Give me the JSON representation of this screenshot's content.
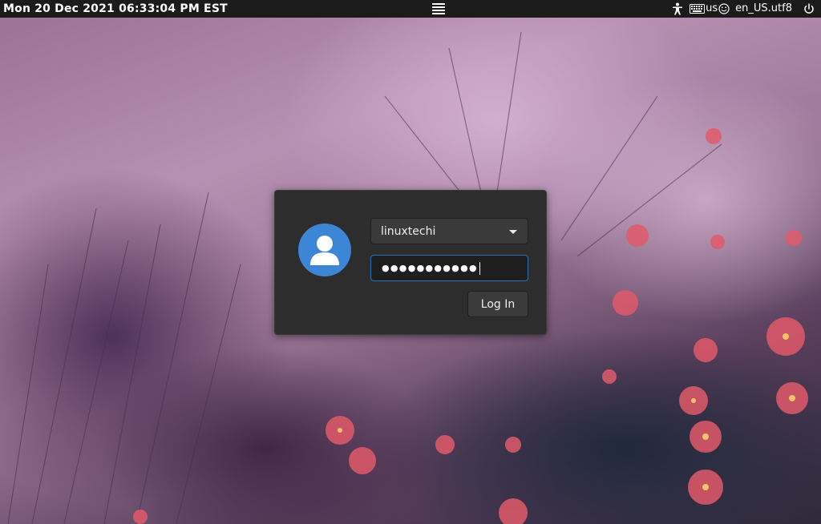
{
  "topbar": {
    "clock": "Mon 20 Dec 2021 06:33:04 PM EST",
    "menu_icon": "hamburger-menu-icon",
    "tray": {
      "accessibility_icon": "accessibility-icon",
      "keyboard_icon": "keyboard-icon",
      "keyboard_layout": "us",
      "onscreen_keyboard_icon": "smiley-icon",
      "locale": "en_US.utf8",
      "power_icon": "power-icon"
    }
  },
  "login": {
    "avatar_icon": "user-avatar-icon",
    "username": "linuxtechi",
    "password_mask": "●●●●●●●●●●●",
    "login_button": "Log In"
  },
  "colors": {
    "topbar_bg": "#1b1b1b",
    "dialog_bg": "#2d2d2d",
    "avatar_bg": "#3d86d6",
    "focus_border": "#2f6fb7"
  }
}
